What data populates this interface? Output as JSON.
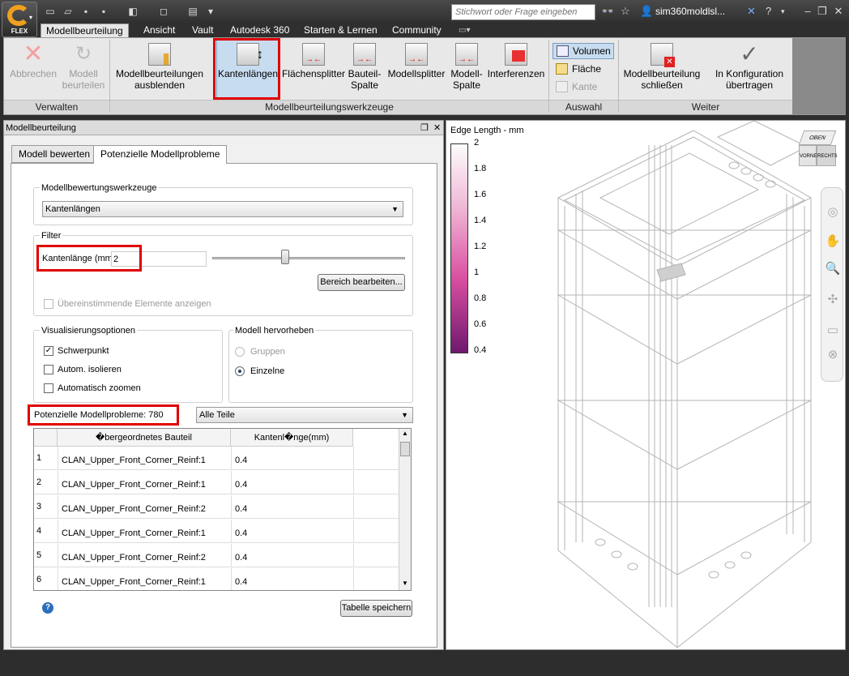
{
  "app": {
    "logo_label": "FLEX"
  },
  "search": {
    "placeholder": "Stichwort oder Frage eingeben"
  },
  "user": {
    "name": "sim360moldlsl..."
  },
  "ribbon_tabs": [
    "Modellbeurteilung",
    "Ansicht",
    "Vault",
    "Autodesk 360",
    "Starten & Lernen",
    "Community"
  ],
  "ribbon": {
    "verwalten": {
      "abbrechen": "Abbrechen",
      "modell_beurteilen": [
        "Modell",
        "beurteilen"
      ],
      "group_label": "Verwalten"
    },
    "werkzeuge": {
      "ausblenden": [
        "Modellbeurteilungen",
        "ausblenden"
      ],
      "kantenlaengen": "Kantenlängen",
      "flaechensplitter": "Flächensplitter",
      "bauteil_spalte": [
        "Bauteil-",
        "Spalte"
      ],
      "modellsplitter": "Modellsplitter",
      "modell_spalte": [
        "Modell-",
        "Spalte"
      ],
      "interferenzen": "Interferenzen",
      "group_label": "Modellbeurteilungswerkzeuge"
    },
    "auswahl": {
      "volumen": "Volumen",
      "flaeche": "Fläche",
      "kante": "Kante",
      "group_label": "Auswahl"
    },
    "weiter": {
      "schliessen": [
        "Modellbeurteilung",
        "schließen"
      ],
      "uebertragen": [
        "In Konfiguration",
        "übertragen"
      ],
      "group_label": "Weiter"
    }
  },
  "panel": {
    "title": "Modellbeurteilung",
    "tabs": [
      "Modell bewerten",
      "Potenzielle Modellprobleme"
    ],
    "tools_legend": "Modellbewertungswerkzeuge",
    "tools_value": "Kantenlängen",
    "filter_legend": "Filter",
    "edge_label": "Kantenlänge (mm)",
    "edge_value": "2",
    "slider_value": 0.38,
    "range_button": "Bereich bearbeiten...",
    "matching_label": "Übereinstimmende Elemente anzeigen",
    "vis_legend": "Visualisierungsoptionen",
    "vis_options": [
      {
        "label": "Schwerpunkt",
        "checked": true
      },
      {
        "label": "Autom. isolieren",
        "checked": false
      },
      {
        "label": "Automatisch zoomen",
        "checked": false
      }
    ],
    "highlight_legend": "Modell hervorheben",
    "highlight_options": [
      {
        "label": "Gruppen",
        "selected": false,
        "disabled": true
      },
      {
        "label": "Einzelne",
        "selected": true,
        "disabled": false
      }
    ],
    "problems_label": "Potenzielle Modellprobleme:",
    "problems_count": "780",
    "parts_filter": "Alle Teile",
    "table": {
      "headers": [
        "�bergeordnetes Bauteil",
        "Kantenl�nge(mm)"
      ],
      "rows": [
        {
          "n": "1",
          "part": "CLAN_Upper_Front_Corner_Reinf:1",
          "len": "0.4"
        },
        {
          "n": "2",
          "part": "CLAN_Upper_Front_Corner_Reinf:1",
          "len": "0.4"
        },
        {
          "n": "3",
          "part": "CLAN_Upper_Front_Corner_Reinf:2",
          "len": "0.4"
        },
        {
          "n": "4",
          "part": "CLAN_Upper_Front_Corner_Reinf:1",
          "len": "0.4"
        },
        {
          "n": "5",
          "part": "CLAN_Upper_Front_Corner_Reinf:2",
          "len": "0.4"
        },
        {
          "n": "6",
          "part": "CLAN_Upper_Front_Corner_Reinf:1",
          "len": "0.4"
        }
      ]
    },
    "save_button": "Tabelle speichern"
  },
  "viewport": {
    "legend_title": "Edge Length - mm",
    "legend_ticks": [
      "2",
      "1.8",
      "1.6",
      "1.4",
      "1.2",
      "1",
      "0.8",
      "0.6",
      "0.4"
    ],
    "viewcube": {
      "top": "OBEN",
      "front": "VORNE",
      "right": "RECHTS"
    }
  },
  "colors": {
    "highlight_box": "#e00000",
    "legend_top": "#fcfcfc",
    "legend_bottom": "#6e1a6e"
  }
}
